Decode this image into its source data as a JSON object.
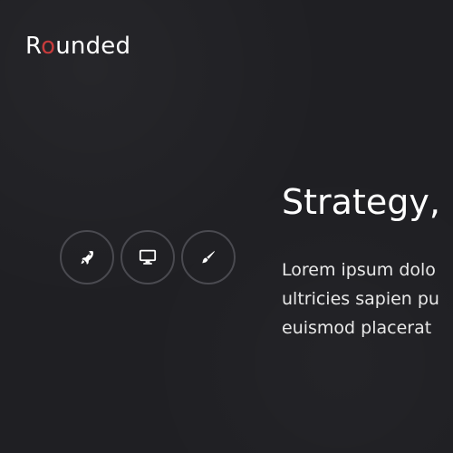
{
  "brand": {
    "first_letter": "R",
    "accent_letter": "o",
    "rest": "unded"
  },
  "hero": {
    "title": "Strategy,",
    "paragraph_lines": [
      "Lorem ipsum dolo",
      "ultricies sapien pu",
      "euismod placerat"
    ]
  },
  "icons": [
    {
      "name": "rocket-icon"
    },
    {
      "name": "monitor-icon"
    },
    {
      "name": "brush-icon"
    }
  ],
  "colors": {
    "background": "#1f1f23",
    "text": "#ffffff",
    "accent": "#c63b3b",
    "circle_border": "#4a4a50"
  }
}
